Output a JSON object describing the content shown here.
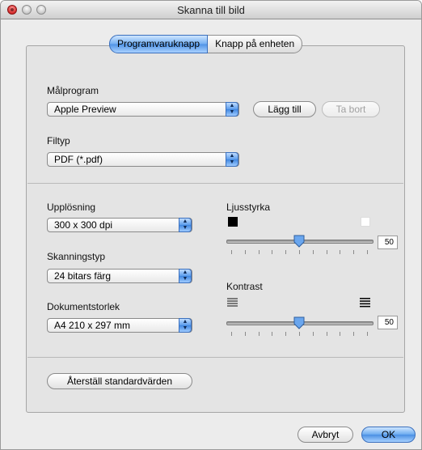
{
  "window": {
    "title": "Skanna till bild"
  },
  "tabs": [
    {
      "label": "Programvaruknapp",
      "selected": true
    },
    {
      "label": "Knapp på enheten",
      "selected": false
    }
  ],
  "target_app": {
    "label": "Målprogram",
    "value": "Apple Preview",
    "add_label": "Lägg till",
    "remove_label": "Ta bort"
  },
  "file_type": {
    "label": "Filtyp",
    "value": "PDF (*.pdf)"
  },
  "resolution": {
    "label": "Upplösning",
    "value": "300 x 300 dpi"
  },
  "scan_type": {
    "label": "Skanningstyp",
    "value": "24 bitars färg"
  },
  "doc_size": {
    "label": "Dokumentstorlek",
    "value": "A4 210 x 297 mm"
  },
  "brightness": {
    "label": "Ljusstyrka",
    "value": "50",
    "level": 0.5
  },
  "contrast": {
    "label": "Kontrast",
    "value": "50",
    "level": 0.5
  },
  "restore_defaults": {
    "label": "Återställ standardvärden"
  },
  "footer": {
    "cancel_label": "Avbryt",
    "ok_label": "OK"
  },
  "icons": {
    "brightness_low": "black-square-icon",
    "brightness_high": "white-square-icon",
    "contrast_low": "low-contrast-icon",
    "contrast_high": "high-contrast-icon"
  }
}
